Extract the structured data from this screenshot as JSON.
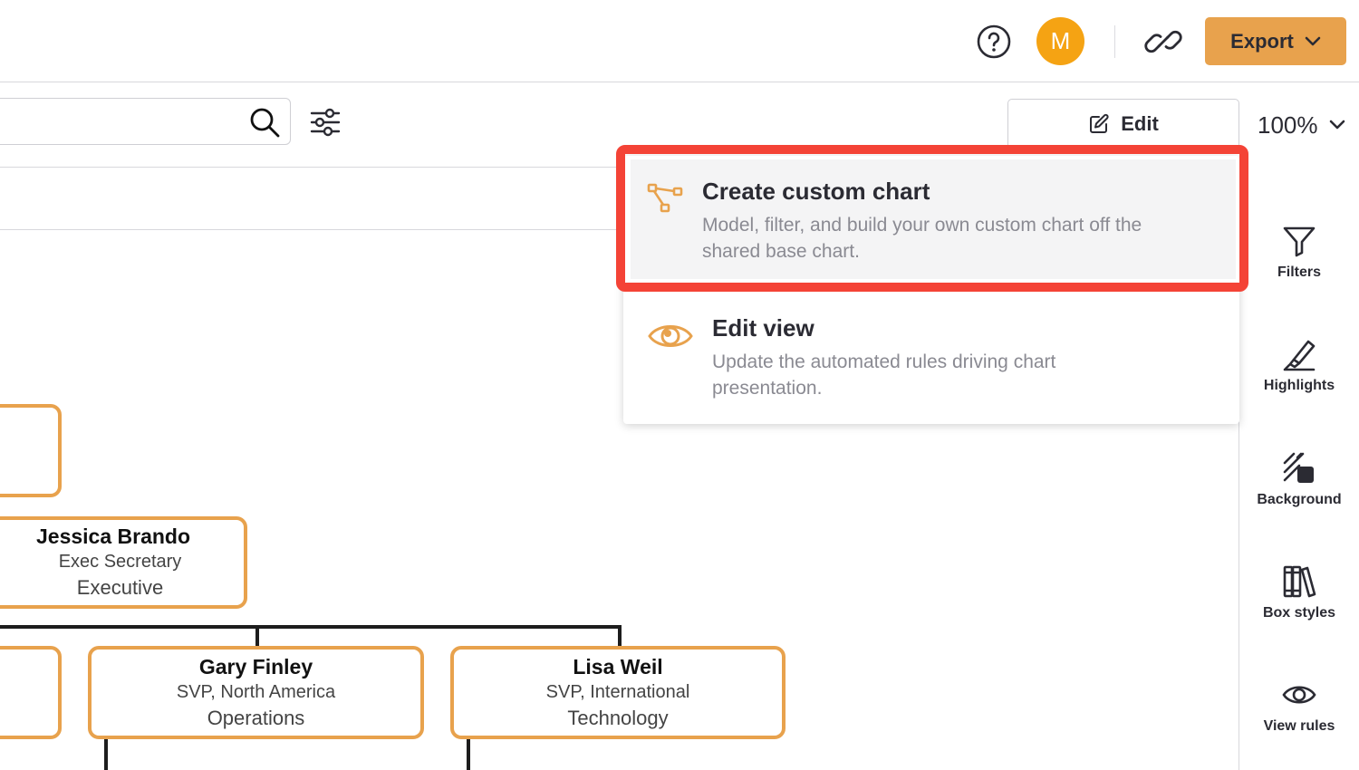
{
  "header": {
    "avatar_initial": "M",
    "export_label": "Export"
  },
  "toolbar": {
    "edit_label": "Edit",
    "zoom_level": "100%"
  },
  "dropdown": {
    "items": [
      {
        "title": "Create custom chart",
        "desc_line1": "Model, filter, and build your own custom chart off the",
        "desc_line2": "shared base chart.",
        "icon": "custom-chart-icon"
      },
      {
        "title": "Edit view",
        "desc_line1": "Update the automated rules driving chart",
        "desc_line2": "presentation.",
        "icon": "eye-icon"
      }
    ]
  },
  "sidebar": {
    "tools": [
      {
        "label": "Filters",
        "icon": "funnel-icon"
      },
      {
        "label": "Highlights",
        "icon": "highlighter-icon"
      },
      {
        "label": "Background",
        "icon": "background-icon"
      },
      {
        "label": "Box styles",
        "icon": "books-icon"
      },
      {
        "label": "View rules",
        "icon": "eye-icon"
      }
    ]
  },
  "org_chart": {
    "nodes": [
      {
        "name": "Jessica Brando",
        "title": "Exec Secretary",
        "dept": "Executive"
      },
      {
        "name": "Gary Finley",
        "title": "SVP, North America",
        "dept": "Operations"
      },
      {
        "name": "Lisa Weil",
        "title": "SVP, International",
        "dept": "Technology"
      }
    ]
  },
  "colors": {
    "accent": "#e8a24d",
    "avatar": "#f5a313",
    "highlight": "#f44336"
  }
}
